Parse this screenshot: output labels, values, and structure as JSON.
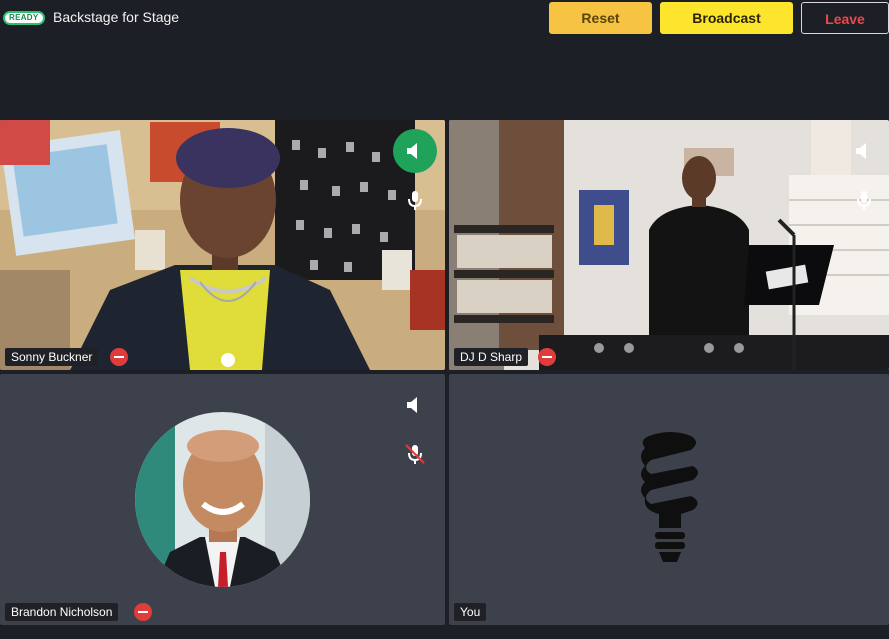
{
  "header": {
    "status": "READY",
    "title": "Backstage for Stage",
    "reset_label": "Reset",
    "broadcast_label": "Broadcast",
    "leave_label": "Leave"
  },
  "participants": [
    {
      "name": "Sonny Buckner"
    },
    {
      "name": "DJ D Sharp"
    },
    {
      "name": "Brandon Nicholson"
    },
    {
      "name": "You"
    }
  ],
  "colors": {
    "background": "#1c1f26",
    "tile": "#3d414c",
    "ready": "#2fbf71",
    "reset": "#f6c343",
    "broadcast": "#fde52e",
    "leave": "#e84b4b",
    "remove": "#e03c3c",
    "speaking": "#1fa35a"
  },
  "icons": [
    "speaker-icon",
    "mic-icon",
    "mic-muted-icon",
    "remove-icon",
    "lightbulb-icon"
  ]
}
